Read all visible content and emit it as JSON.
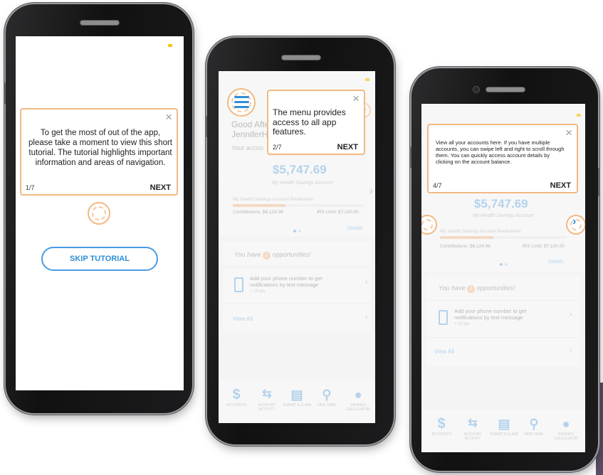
{
  "phone1": {
    "tooltip": {
      "message": "To get the most of out of the app, please take a moment to view this short tutorial. The tutorial highlights important information and areas of navigation.",
      "counter": "1/7",
      "next": "NEXT",
      "close": "×"
    },
    "skip_button": "SKIP TUTORIAL"
  },
  "phone2": {
    "tooltip": {
      "message": "The menu provides access to all app features.",
      "counter": "2/7",
      "next": "NEXT",
      "close": "×"
    },
    "greeting_line1": "Good Afte",
    "greeting_line2": "JenniferH",
    "your_accounts": "Your accou",
    "balance": "$5,747.69",
    "account_name": "My Health Savings Account",
    "breakdown": "My Health Savings Account Breakdown",
    "contributions": "Contributions: $6,124.96",
    "irs_limit": "IRS Limit: $7,100.00",
    "details": "Details",
    "opps_prefix": "You have",
    "opps_count": "2",
    "opps_suffix": "opportunities!",
    "opp_item_title": "Add your phone number to get notifications by text message",
    "opp_item_meta": "+ 10 pts",
    "view_all": "View All"
  },
  "phone3": {
    "tooltip": {
      "message": "View all your accounts here. If you have multiple accounts, you can swipe left and right to scroll through them. You can quickly access account details by clicking on the account balance.",
      "counter": "4/7",
      "next": "NEXT",
      "close": "×"
    },
    "balance": "$5,747.69",
    "account_name": "My Health Savings Account",
    "breakdown": "My Health Savings Account Breakdown",
    "contributions": "Contributions: $6,124.96",
    "irs_limit": "IRS Limit: $7,100.00",
    "details": "Details",
    "opps_prefix": "You have",
    "opps_count": "2",
    "opps_suffix": "opportunities!",
    "opp_item_title": "Add your phone number to get notifications by text message",
    "opp_item_meta": "+ 10 pts",
    "view_all": "View All"
  },
  "tabbar": {
    "items": [
      {
        "label": "ACCOUNTS",
        "icon": "dollar-icon",
        "glyph": "$"
      },
      {
        "label": "ACCOUNT ACTIVITY",
        "icon": "activity-icon",
        "glyph": "⇆"
      },
      {
        "label": "SUBMIT A CLAIM",
        "icon": "clipboard-icon",
        "glyph": "▤"
      },
      {
        "label": "FIND CARE",
        "icon": "location-pin-icon",
        "glyph": "⚲"
      },
      {
        "label": "SAVINGS CALCULATOR",
        "icon": "piggy-bank-icon",
        "glyph": "●"
      }
    ]
  },
  "colors": {
    "accent": "#2f8ed8",
    "tooltip_border": "#f3b981",
    "progress": "#f3a35f",
    "status": "#f5c518"
  }
}
